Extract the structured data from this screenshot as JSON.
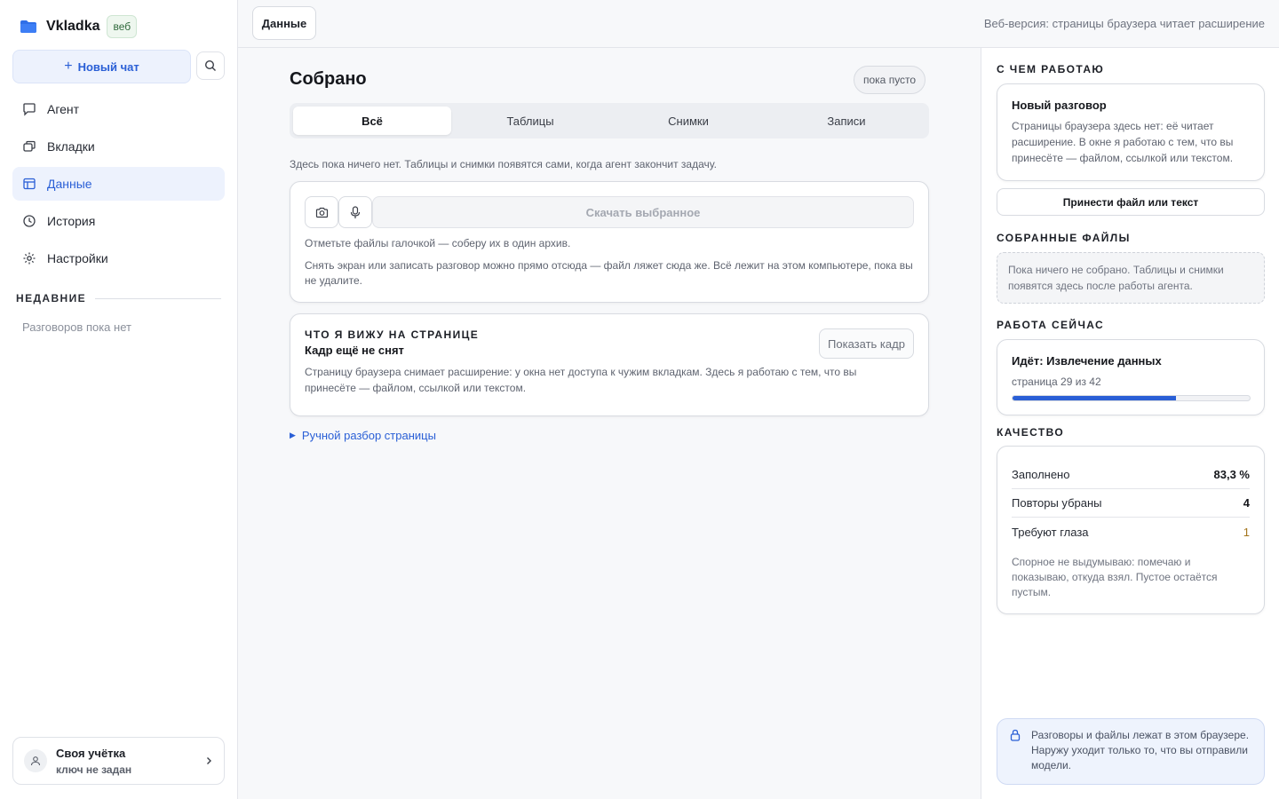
{
  "brand": {
    "name": "Vkladka",
    "badge": "веб"
  },
  "sidebar": {
    "new_chat": "Новый чат",
    "nav": [
      {
        "label": "Агент",
        "icon": "chat-icon"
      },
      {
        "label": "Вкладки",
        "icon": "tabs-icon"
      },
      {
        "label": "Данные",
        "icon": "table-icon",
        "active": true
      },
      {
        "label": "История",
        "icon": "clock-icon"
      },
      {
        "label": "Настройки",
        "icon": "gear-icon"
      }
    ],
    "recent_title": "НЕДАВНИЕ",
    "recent_empty": "Разговоров пока нет",
    "account": {
      "title": "Своя учётка",
      "subtitle": "ключ не задан"
    }
  },
  "topbar": {
    "tab_label": "Данные",
    "note": "Веб-версия: страницы браузера читает расширение"
  },
  "main": {
    "title": "Собрано",
    "status_pill": "пока пусто",
    "tabs": [
      "Всё",
      "Таблицы",
      "Снимки",
      "Записи"
    ],
    "hint": "Здесь пока ничего нет. Таблицы и снимки появятся сами, когда агент закончит задачу.",
    "capture_card": {
      "download_label": "Скачать выбранное",
      "line1": "Отметьте файлы галочкой — соберу их в один архив.",
      "line2": "Снять экран или записать разговор можно прямо отсюда — файл ляжет сюда же. Всё лежит на этом компьютере, пока вы не удалите."
    },
    "page_card": {
      "overline": "ЧТО Я ВИЖУ НА СТРАНИЦЕ",
      "subtitle": "Кадр ещё не снят",
      "show_button": "Показать кадр",
      "description": "Страницу браузера снимает расширение: у окна нет доступа к чужим вкладкам. Здесь я работаю с тем, что вы принесёте — файлом, ссылкой или текстом."
    },
    "manual_link": "Ручной разбор страницы"
  },
  "right": {
    "working_with_title": "С ЧЕМ РАБОТАЮ",
    "conversation": {
      "title": "Новый разговор",
      "description": "Страницы браузера здесь нет: её читает расширение. В окне я работаю с тем, что вы принесёте — файлом, ссылкой или текстом."
    },
    "bring_button": "Принести файл или текст",
    "files_title": "СОБРАННЫЕ ФАЙЛЫ",
    "files_empty": "Пока ничего не собрано. Таблицы и снимки появятся здесь после работы агента.",
    "work_title": "РАБОТА СЕЙЧАС",
    "work": {
      "status": "Идёт: Извлечение данных",
      "progress_text": "страница 29 из 42",
      "progress_fraction": 0.69
    },
    "quality_title": "КАЧЕСТВО",
    "quality": {
      "rows": [
        {
          "label": "Заполнено",
          "value": "83,3 %"
        },
        {
          "label": "Повторы убраны",
          "value": "4"
        },
        {
          "label": "Требуют глаза",
          "value": "1"
        }
      ],
      "note": "Спорное не выдумываю: помечаю и показываю, откуда взял. Пустое остаётся пустым."
    },
    "privacy": "Разговоры и файлы лежат в этом браузере. Наружу уходит только то, что вы отправили модели."
  },
  "colors": {
    "accent": "#2a5fd6",
    "accent_soft": "#edf2fd",
    "warn": "#a3751c"
  }
}
